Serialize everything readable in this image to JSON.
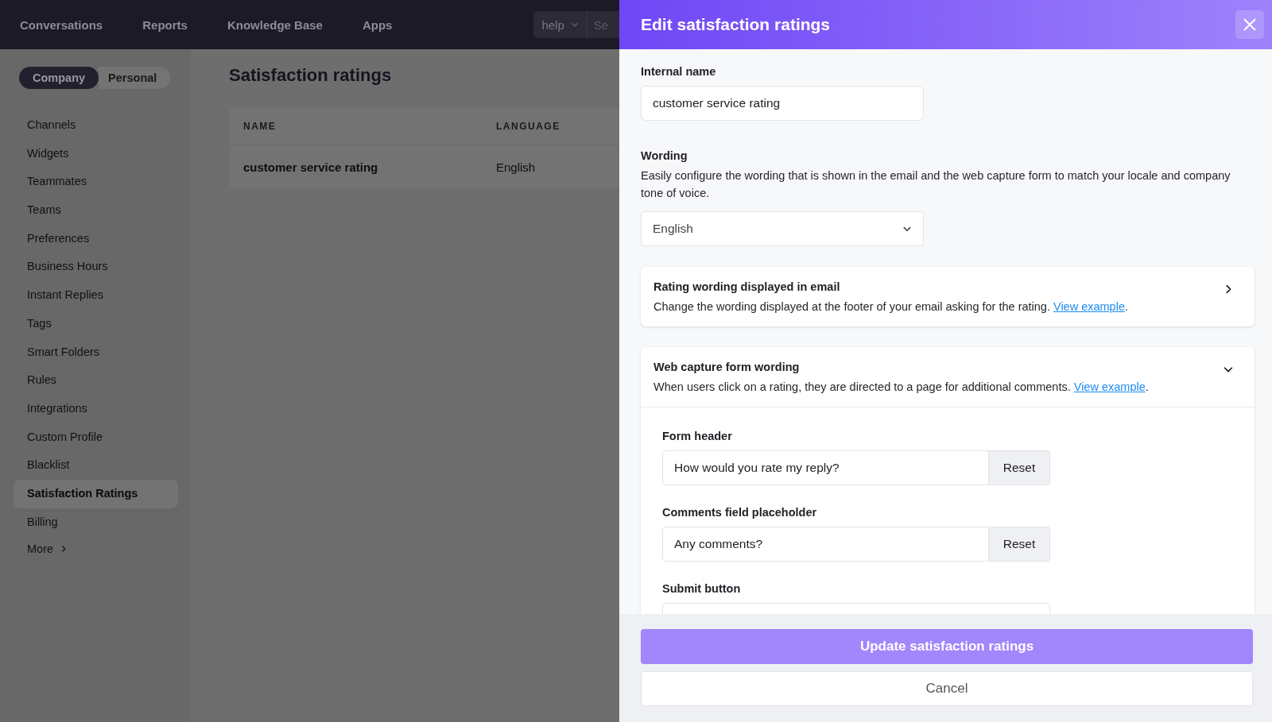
{
  "top_nav": {
    "items": [
      {
        "label": "Conversations"
      },
      {
        "label": "Reports"
      },
      {
        "label": "Knowledge Base"
      },
      {
        "label": "Apps"
      }
    ],
    "mailbox_select": {
      "value": "help"
    },
    "search": {
      "placeholder": "Se"
    }
  },
  "scope_toggle": [
    {
      "label": "Company",
      "selected": true
    },
    {
      "label": "Personal",
      "selected": false
    }
  ],
  "sidebar": {
    "items": [
      {
        "label": "Channels",
        "selected": false
      },
      {
        "label": "Widgets",
        "selected": false
      },
      {
        "label": "Teammates",
        "selected": false
      },
      {
        "label": "Teams",
        "selected": false
      },
      {
        "label": "Preferences",
        "selected": false
      },
      {
        "label": "Business Hours",
        "selected": false
      },
      {
        "label": "Instant Replies",
        "selected": false
      },
      {
        "label": "Tags",
        "selected": false
      },
      {
        "label": "Smart Folders",
        "selected": false
      },
      {
        "label": "Rules",
        "selected": false
      },
      {
        "label": "Integrations",
        "selected": false
      },
      {
        "label": "Custom Profile",
        "selected": false
      },
      {
        "label": "Blacklist",
        "selected": false
      },
      {
        "label": "Satisfaction Ratings",
        "selected": true
      },
      {
        "label": "Billing",
        "selected": false
      }
    ],
    "more": "More"
  },
  "page": {
    "title": "Satisfaction ratings",
    "table": {
      "columns": [
        "NAME",
        "LANGUAGE"
      ],
      "rows": [
        [
          "customer service rating",
          "English"
        ]
      ]
    }
  },
  "drawer": {
    "title": "Edit satisfaction ratings",
    "internal_name": {
      "label": "Internal name",
      "value": "customer service rating"
    },
    "wording": {
      "label": "Wording",
      "description": "Easily configure the wording that is shown in the email and the web capture form to match your locale and company tone of voice.",
      "language": "English"
    },
    "sections": [
      {
        "title": "Rating wording displayed in email",
        "description": "Change the wording displayed at the footer of your email asking for the rating.",
        "link": "View example",
        "suffix": ".",
        "expanded": false
      },
      {
        "title": "Web capture form wording",
        "description": "When users click on a rating, they are directed to a page for additional comments.",
        "link": "View example",
        "suffix": ".",
        "expanded": true,
        "fields": [
          {
            "label": "Form header",
            "value": "How would you rate my reply?",
            "button": "Reset"
          },
          {
            "label": "Comments field placeholder",
            "value": "Any comments?",
            "button": "Reset"
          },
          {
            "label": "Submit button"
          }
        ]
      }
    ],
    "primary_button": "Update satisfaction ratings",
    "cancel_button": "Cancel"
  }
}
